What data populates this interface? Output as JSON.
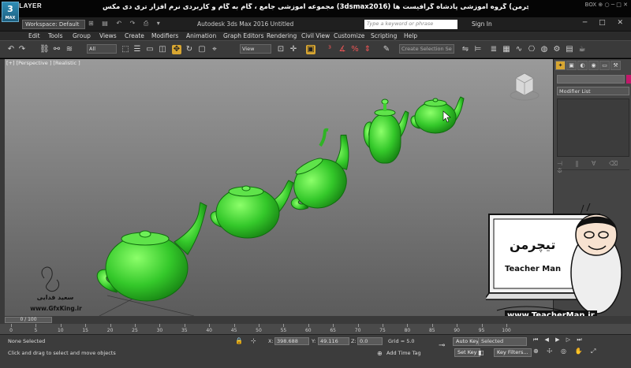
{
  "player": {
    "logo": "KMPLAYER",
    "title": "مجموعه آموزشی جامع ، گام به گام و کاربردی نرم افزار تری دی مکس (3dsmax2016)  مدرس : سعید فدایی (تیچرمن) گروه آموزشی پادشاه گرافیست ها",
    "controls": "BOX ⊕ ○ ─ □ ✕"
  },
  "max": {
    "logo": "3",
    "logo_sub": "MAX",
    "workspace": "Workspace: Default",
    "app_title": "Autodesk 3ds Max 2016      Untitled",
    "search_placeholder": "Type a keyword or phrase",
    "sign_in": "Sign In",
    "window_buttons": "─ □ ✕"
  },
  "menu": [
    "Edit",
    "Tools",
    "Group",
    "Views",
    "Create",
    "Modifiers",
    "Animation",
    "Graph Editors",
    "Rendering",
    "Civil View",
    "Customize",
    "Scripting",
    "Help"
  ],
  "toolbar": {
    "filter": "All",
    "ref_coord": "View",
    "selection_set": "Create Selection Se"
  },
  "viewport": {
    "label": "[+] [Perspective ] [Realistic ]",
    "object_color": "#3fcf2f"
  },
  "command_panel": {
    "modifier_list": "Modifier List",
    "tabs": [
      "✦",
      "▣",
      "◐",
      "◉",
      "▭",
      "⚒"
    ]
  },
  "timeline": {
    "frame": "0 / 100",
    "ticks": [
      "0",
      "5",
      "10",
      "15",
      "20",
      "25",
      "30",
      "35",
      "40",
      "45",
      "50",
      "55",
      "60",
      "65",
      "70",
      "75",
      "80",
      "85",
      "90",
      "95",
      "100"
    ]
  },
  "status": {
    "selection": "None Selected",
    "prompt": "Click and drag to select and move objects",
    "x_label": "X:",
    "x_value": "398.688",
    "y_label": "Y:",
    "y_value": "49.116",
    "z_label": "Z:",
    "z_value": "0.0",
    "grid": "Grid = 5.0",
    "add_time_tag": "Add Time Tag",
    "auto_key": "Auto Key",
    "set_key": "Set Key",
    "key_filter": "Selected",
    "key_filters_btn": "Key Filters..."
  },
  "watermark": {
    "brand": "Teacher Man",
    "brand_fa": "تیچرمن",
    "url": "www.TeacherMan.ir",
    "sig_name": "سعید فدایی",
    "sig_url": "www.GfxKing.ir"
  }
}
